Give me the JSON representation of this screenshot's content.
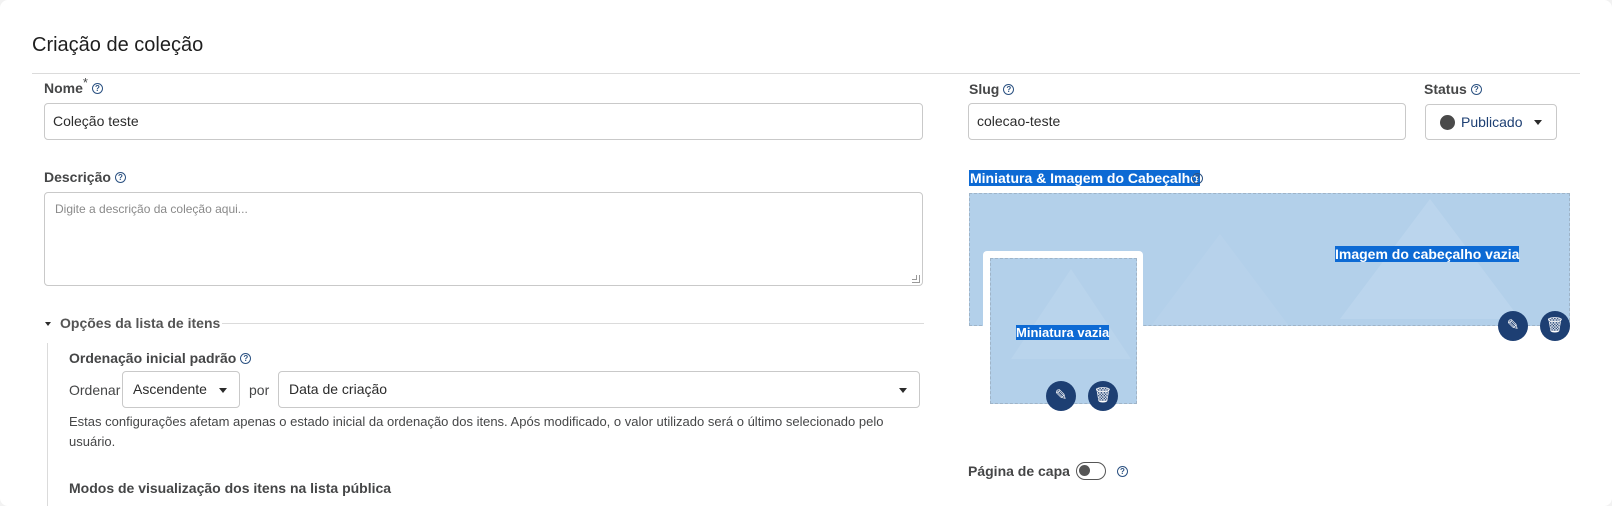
{
  "page": {
    "title": "Criação de coleção"
  },
  "name_field": {
    "label": "Nome",
    "required_mark": "*",
    "value": "Coleção teste"
  },
  "slug_field": {
    "label": "Slug",
    "value": "colecao-teste"
  },
  "status_field": {
    "label": "Status",
    "value": "Publicado"
  },
  "description_field": {
    "label": "Descrição",
    "placeholder": "Digite a descrição da coleção aqui..."
  },
  "list_options": {
    "section_title": "Opções da lista de itens",
    "ordering_label": "Ordenação inicial padrão",
    "order_prefix": "Ordenar",
    "order_direction": "Ascendente",
    "by_label": "por",
    "order_by": "Data de criação",
    "ordering_help_text": "Estas configurações afetam apenas o estado inicial da ordenação dos itens. Após modificado, o valor utilizado será o último selecionado pelo usuário.",
    "view_modes_label": "Modos de visualização dos itens na lista pública"
  },
  "media": {
    "label": "Miniatura & Imagem do Cabeçalho",
    "header_empty": "Imagem do cabeçalho vazia",
    "thumbnail_empty": "Miniatura vazia",
    "edit_icon": "✎",
    "delete_icon": "🗑"
  },
  "cover_page": {
    "label": "Página de capa",
    "enabled": false
  },
  "colors": {
    "accent": "#1d3f73",
    "selection": "#0d6ad4",
    "dropzone": "#b3d0ea"
  }
}
